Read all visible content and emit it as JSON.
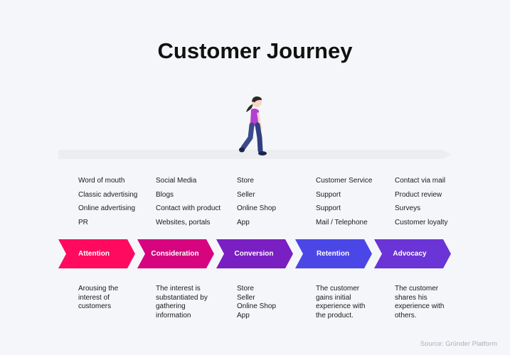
{
  "title": "Customer Journey",
  "figure": {
    "name": "walking-woman",
    "shirt_color": "#b43fd3",
    "pants_color": "#3a4a8c",
    "hair_color": "#2a2a2a"
  },
  "track_color": "#ebedf1",
  "touchpoints": [
    [
      "Word of mouth",
      "Classic advertising",
      "Online advertising",
      "PR"
    ],
    [
      "Social Media",
      "Blogs",
      "Contact with product",
      "Websites, portals"
    ],
    [
      "Store",
      "Seller",
      "Online Shop",
      "App"
    ],
    [
      "Customer Service",
      "Support",
      "Support",
      "Mail / Telephone"
    ],
    [
      "Contact via mail",
      "Product review",
      "Surveys",
      "Customer loyalty"
    ]
  ],
  "stages": [
    {
      "label": "Attention",
      "color": "#ff0a5f"
    },
    {
      "label": "Consideration",
      "color": "#d6047f"
    },
    {
      "label": "Conversion",
      "color": "#7a1fc1"
    },
    {
      "label": "Retention",
      "color": "#4b47e6"
    },
    {
      "label": "Advocacy",
      "color": "#6b34d6"
    }
  ],
  "descriptions": [
    [
      "Arousing the",
      "interest of",
      "customers"
    ],
    [
      "The interest is",
      "substantiated by",
      "gathering",
      "information"
    ],
    [
      "Store",
      "Seller",
      "Online Shop",
      "App"
    ],
    [
      "The customer",
      "gains initial",
      "experience with",
      "the product."
    ],
    [
      "The customer",
      "shares his",
      "experience with",
      "others."
    ]
  ],
  "source": "Source: Gründer Platform"
}
